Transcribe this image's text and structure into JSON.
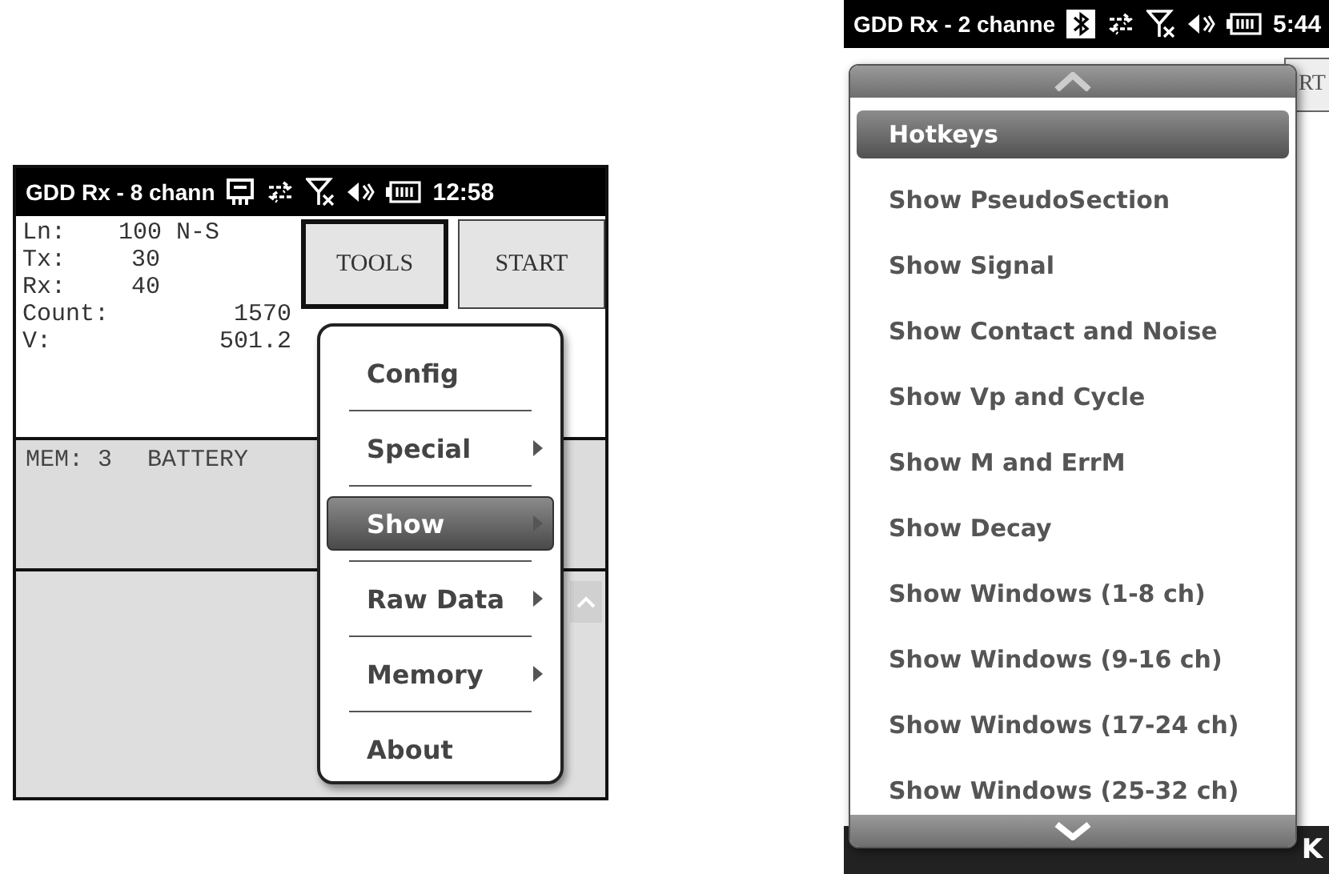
{
  "left_screen": {
    "status_bar": {
      "title": "GDD Rx - 8 chann",
      "time": "12:58"
    },
    "channel_lines": [
      {
        "label": "Ln:",
        "value": "100 N-S"
      },
      {
        "label": "Tx:",
        "value": "30"
      },
      {
        "label": "Rx:",
        "value": "40"
      }
    ],
    "measure_lines": [
      {
        "label": "Count:",
        "value": "1570"
      },
      {
        "label": "V:",
        "value": "501.2"
      }
    ],
    "buttons": [
      {
        "label": "TOOLS",
        "selected": true
      },
      {
        "label": "START",
        "selected": false
      }
    ],
    "memory_line": {
      "mem": "MEM: 3",
      "battery": "BATTERY"
    },
    "menu": {
      "items": [
        {
          "label": "Config",
          "submenu": false,
          "selected": false
        },
        {
          "label": "Special",
          "submenu": true,
          "selected": false
        },
        {
          "label": "Show",
          "submenu": true,
          "selected": true
        },
        {
          "label": "Raw Data",
          "submenu": true,
          "selected": false
        },
        {
          "label": "Memory",
          "submenu": true,
          "selected": false
        },
        {
          "label": "About",
          "submenu": false,
          "selected": false
        }
      ]
    }
  },
  "right_screen": {
    "status_bar": {
      "title": "GDD Rx - 2 channe",
      "time": "5:44"
    },
    "background_button": "RT",
    "softkey": "K",
    "menu": {
      "items": [
        {
          "label": "Hotkeys",
          "selected": true
        },
        {
          "label": "Show PseudoSection",
          "selected": false
        },
        {
          "label": "Show Signal",
          "selected": false
        },
        {
          "label": "Show Contact and Noise",
          "selected": false
        },
        {
          "label": "Show Vp and Cycle",
          "selected": false
        },
        {
          "label": "Show M and ErrM",
          "selected": false
        },
        {
          "label": "Show Decay",
          "selected": false
        },
        {
          "label": "Show Windows (1-8 ch)",
          "selected": false
        },
        {
          "label": "Show Windows (9-16 ch)",
          "selected": false
        },
        {
          "label": "Show Windows (17-24 ch)",
          "selected": false
        },
        {
          "label": "Show Windows (25-32 ch)",
          "selected": false
        }
      ]
    }
  }
}
